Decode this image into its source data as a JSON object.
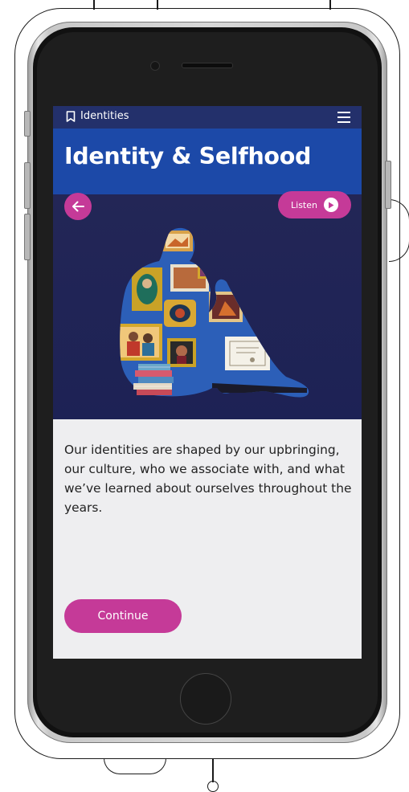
{
  "app": {
    "breadcrumb": "Identities",
    "title": "Identity & Selfhood"
  },
  "controls": {
    "listen_label": "Listen",
    "continue_label": "Continue"
  },
  "content": {
    "body": "Our identities are shaped by our upbringing, our culture, who we associate with, and what we’ve learned about ourselves throughout the years."
  },
  "icons": {
    "bookmark": "bookmark-icon",
    "menu": "hamburger-menu-icon",
    "back": "arrow-left-icon",
    "play": "play-icon"
  },
  "colors": {
    "accent": "#c53a98",
    "header": "#23306b",
    "title_band": "#1c49a8",
    "illustration_bg": "#232656",
    "content_bg": "#eeeef0"
  }
}
